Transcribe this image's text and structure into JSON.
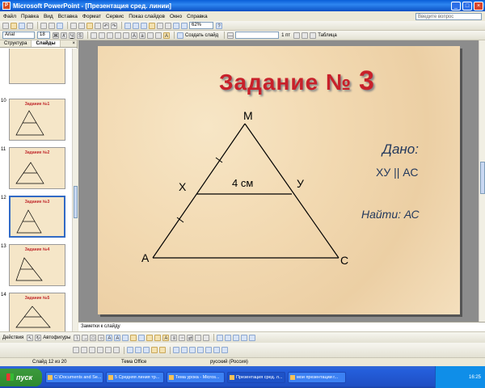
{
  "window": {
    "title": "Microsoft PowerPoint - [Презентация сред. линии]",
    "app_icon": "powerpoint-icon"
  },
  "menu": {
    "items": [
      "Файл",
      "Правка",
      "Вид",
      "Вставка",
      "Формат",
      "Сервис",
      "Показ слайдов",
      "Окно",
      "Справка"
    ],
    "help_placeholder": "Введите вопрос"
  },
  "toolbar": {
    "zoom": "62%",
    "font_name": "Arial",
    "font_size": "18",
    "create_slide": "Создать слайд",
    "line_width": "1 пт",
    "table": "Таблица"
  },
  "left_panel": {
    "tabs": [
      "Структура",
      "Слайды"
    ],
    "close": "×",
    "thumbnails": [
      {
        "number": "",
        "title": "",
        "note": ""
      },
      {
        "number": "10",
        "title": "Задание №1",
        "note": ""
      },
      {
        "number": "11",
        "title": "Задание №2",
        "note": ""
      },
      {
        "number": "12",
        "title": "Задание №3",
        "note": "",
        "selected": true
      },
      {
        "number": "13",
        "title": "Задание №4",
        "note": ""
      },
      {
        "number": "14",
        "title": "Задание №5",
        "note": ""
      }
    ]
  },
  "slide": {
    "title_prefix": "Задание №",
    "title_number": "3",
    "vertex_m": "М",
    "vertex_a": "А",
    "vertex_c": "С",
    "point_x": "Х",
    "point_y": "У",
    "segment_label": "4 см",
    "given_title": "Дано:",
    "given_value": "ХУ || АС",
    "find_label": "Найти: АС"
  },
  "notes": {
    "placeholder": "Заметки к слайду"
  },
  "draw_toolbar": {
    "actions": "Действия",
    "autoshapes": "Автофигуры"
  },
  "status": {
    "slide_info": "Слайд 12 из 20",
    "theme": "Тема Office",
    "language": "русский (Россия)"
  },
  "taskbar": {
    "start": "пуск",
    "tasks": [
      "C:\\Documents and Se...",
      "5 Средняя линия тр...",
      "Тема урока - Micros...",
      "Презентация сред. л...",
      "мои презентации г..."
    ],
    "active_index": 3,
    "clock": "16:25"
  }
}
